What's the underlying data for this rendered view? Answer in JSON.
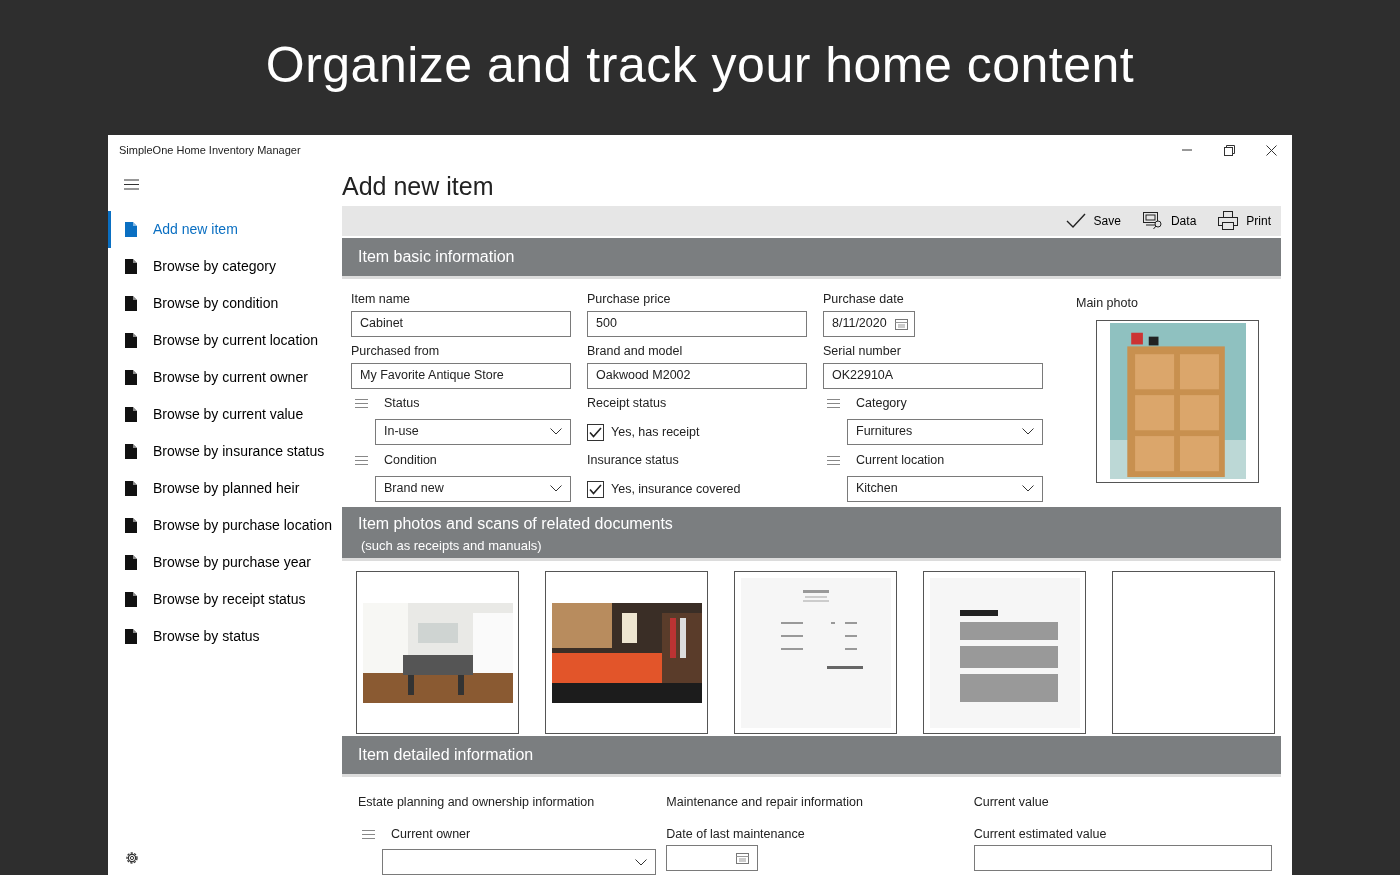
{
  "headline": "Organize and track your home content",
  "window": {
    "title": "SimpleOne Home Inventory Manager"
  },
  "sidebar": {
    "items": [
      {
        "label": "Add new item",
        "selected": true
      },
      {
        "label": "Browse by category",
        "selected": false
      },
      {
        "label": "Browse by condition",
        "selected": false
      },
      {
        "label": "Browse by current location",
        "selected": false
      },
      {
        "label": "Browse by current owner",
        "selected": false
      },
      {
        "label": "Browse by current value",
        "selected": false
      },
      {
        "label": "Browse by insurance status",
        "selected": false
      },
      {
        "label": "Browse by planned heir",
        "selected": false
      },
      {
        "label": "Browse by purchase location",
        "selected": false
      },
      {
        "label": "Browse by purchase year",
        "selected": false
      },
      {
        "label": "Browse by receipt status",
        "selected": false
      },
      {
        "label": "Browse by status",
        "selected": false
      }
    ]
  },
  "page_title": "Add new item",
  "toolbar": [
    {
      "kind": "save",
      "label": "Save"
    },
    {
      "kind": "data",
      "label": "Data"
    },
    {
      "kind": "print",
      "label": "Print"
    }
  ],
  "basic": {
    "title": "Item basic information",
    "fields": [
      {
        "kind": "text",
        "label": "Item name",
        "value": "Cabinet"
      },
      {
        "kind": "text",
        "label": "Purchase price",
        "value": "500"
      },
      {
        "kind": "date",
        "label": "Purchase date",
        "value": "8/11/2020"
      },
      {
        "kind": "text",
        "label": "Purchased from",
        "value": "My Favorite Antique Store"
      },
      {
        "kind": "text",
        "label": "Brand and model",
        "value": "Oakwood M2002"
      },
      {
        "kind": "text",
        "label": "Serial number",
        "value": "OK22910A"
      },
      {
        "kind": "dropdown",
        "label": "Status",
        "value": "In-use"
      },
      {
        "kind": "checkbox",
        "label": "Receipt status",
        "option": "Yes, has receipt",
        "checked": true
      },
      {
        "kind": "dropdown",
        "label": "Category",
        "value": "Furnitures"
      },
      {
        "kind": "dropdown",
        "label": "Condition",
        "value": "Brand new"
      },
      {
        "kind": "checkbox",
        "label": "Insurance status",
        "option": "Yes, insurance covered",
        "checked": true
      },
      {
        "kind": "dropdown",
        "label": "Current location",
        "value": "Kitchen"
      }
    ],
    "main_photo": {
      "label": "Main photo",
      "kind": "picture"
    }
  },
  "photos": {
    "title": "Item photos and scans of related documents",
    "subtitle": "(such as receipts and manuals)",
    "tiles": [
      {
        "kind": "picture"
      },
      {
        "kind": "picture"
      },
      {
        "kind": "picture"
      },
      {
        "kind": "picture"
      },
      {
        "kind": "empty"
      }
    ]
  },
  "detailed": {
    "title": "Item detailed information",
    "groups": [
      {
        "title": "Estate planning and ownership information",
        "field": {
          "kind": "dropdown",
          "label": "Current owner"
        }
      },
      {
        "title": "Maintenance and repair information",
        "field": {
          "kind": "date",
          "label": "Date of last maintenance"
        }
      },
      {
        "title": "Current value",
        "field": {
          "kind": "text",
          "label": "Current estimated value"
        }
      }
    ]
  }
}
